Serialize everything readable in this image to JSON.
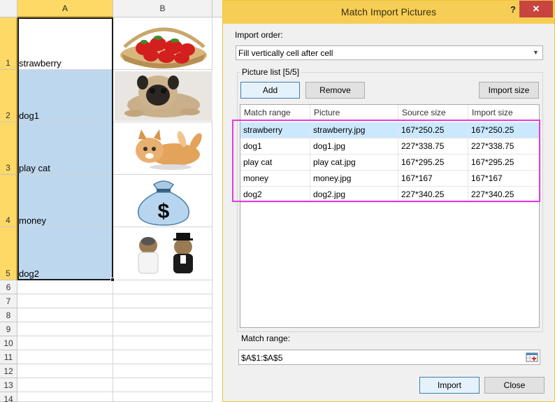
{
  "sheet": {
    "columns": [
      "A",
      "B"
    ],
    "rows": [
      "1",
      "2",
      "3",
      "4",
      "5",
      "6",
      "7",
      "8",
      "9",
      "10",
      "11",
      "12",
      "13",
      "14"
    ],
    "cells": [
      "strawberry",
      "dog1",
      "play cat",
      "money",
      "dog2"
    ],
    "picture_icons": [
      "strawberry-basket",
      "pug-dog",
      "kitten",
      "money-bag",
      "yorkie-dogs"
    ]
  },
  "dialog": {
    "title": "Match Import Pictures",
    "help": "?",
    "close": "✕",
    "import_order_label": "Import order:",
    "import_order_value": "Fill vertically cell after cell",
    "picture_list_label": "Picture list [5/5]",
    "buttons": {
      "add": "Add",
      "remove": "Remove",
      "import_size": "Import size",
      "import": "Import",
      "close": "Close"
    },
    "table": {
      "headers": [
        "Match range",
        "Picture",
        "Source size",
        "Import size"
      ],
      "rows": [
        [
          "strawberry",
          "strawberry.jpg",
          "167*250.25",
          "167*250.25"
        ],
        [
          "dog1",
          "dog1.jpg",
          "227*338.75",
          "227*338.75"
        ],
        [
          "play cat",
          "play cat.jpg",
          "167*295.25",
          "167*295.25"
        ],
        [
          "money",
          "money.jpg",
          "167*167",
          "167*167"
        ],
        [
          "dog2",
          "dog2.jpg",
          "227*340.25",
          "227*340.25"
        ]
      ]
    },
    "match_range_label": "Match range:",
    "match_range_value": "$A$1:$A$5"
  },
  "colors": {
    "title_bar": "#f7ce55",
    "close_button": "#c7453e",
    "selection": "#bdd7ee",
    "highlight": "#e23be0"
  }
}
